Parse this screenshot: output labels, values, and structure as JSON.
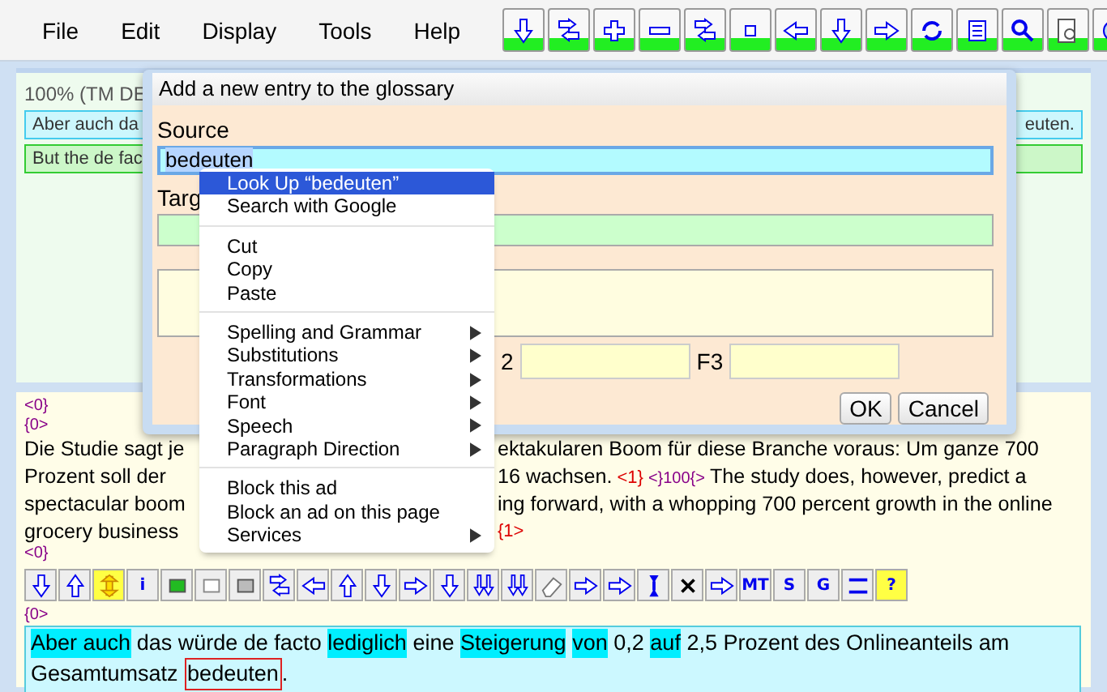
{
  "menubar": {
    "items": [
      "File",
      "Edit",
      "Display",
      "Tools",
      "Help"
    ]
  },
  "top_pane": {
    "match_label": "100% (TM DE",
    "source_row": {
      "left": "Aber auch da",
      "right": "euten."
    },
    "target_row": {
      "left": "But the de fac"
    }
  },
  "bottom_pane": {
    "tag_close": "<0}",
    "tag_open": "{0>",
    "paragraph": [
      {
        "left": "Die Studie sagt je",
        "right": [
          {
            "kind": "text",
            "text": "ektakularen Boom für diese Branche voraus: Um ganze 700"
          }
        ]
      },
      {
        "left": "Prozent soll der",
        "right": [
          {
            "kind": "text",
            "text": "16 wachsen."
          },
          {
            "kind": "tag-red",
            "text": "<1}"
          },
          {
            "kind": "tag",
            "text": "<}100{>"
          },
          {
            "kind": "text",
            "text": "The study does, however, predict a"
          }
        ]
      },
      {
        "left": "spectacular boom",
        "right": [
          {
            "kind": "text",
            "text": "ing forward, with a whopping 700 percent growth in the online"
          }
        ]
      },
      {
        "left": "grocery business",
        "right": [
          {
            "kind": "tag-red",
            "text": "{1>"
          }
        ]
      }
    ],
    "tag_close_2": "<0}",
    "toolbar_texts": [
      "i",
      "MT",
      "S",
      "G",
      "?"
    ],
    "tag_open_2": "{0>",
    "segment": [
      {
        "text": "Aber auch",
        "kind": "highlight"
      },
      {
        "text": "das würde de facto",
        "kind": "plain"
      },
      {
        "text": "lediglich",
        "kind": "highlight"
      },
      {
        "text": "eine",
        "kind": "plain"
      },
      {
        "text": "Steigerung",
        "kind": "highlight"
      },
      {
        "text": "von",
        "kind": "highlight"
      },
      {
        "text": "0,2",
        "kind": "plain"
      },
      {
        "text": "auf",
        "kind": "highlight"
      },
      {
        "text": "2,5 Prozent des Onlineanteils am",
        "kind": "plain"
      },
      {
        "text": "Gesamtumsatz",
        "kind": "plain"
      },
      {
        "text": "bedeuten",
        "kind": "boxed"
      },
      {
        "text": ".",
        "kind": "punct"
      }
    ]
  },
  "dialog": {
    "title": "Add a new entry to the glossary",
    "source_label": "Source",
    "source_value": "bedeuten",
    "target_label": "Targ",
    "f2_label": "2",
    "f3_label": "F3",
    "buttons": [
      "OK",
      "Cancel"
    ]
  },
  "context_menu": [
    {
      "label": "Look Up “bedeuten”",
      "selected": true,
      "submenu": false,
      "divider_after": false
    },
    {
      "label": "Search with Google",
      "selected": false,
      "submenu": false,
      "divider_after": true
    },
    {
      "label": "Cut",
      "selected": false,
      "submenu": false,
      "divider_after": false
    },
    {
      "label": "Copy",
      "selected": false,
      "submenu": false,
      "divider_after": false
    },
    {
      "label": "Paste",
      "selected": false,
      "submenu": false,
      "divider_after": true
    },
    {
      "label": "Spelling and Grammar",
      "selected": false,
      "submenu": true,
      "divider_after": false
    },
    {
      "label": "Substitutions",
      "selected": false,
      "submenu": true,
      "divider_after": false
    },
    {
      "label": "Transformations",
      "selected": false,
      "submenu": true,
      "divider_after": false
    },
    {
      "label": "Font",
      "selected": false,
      "submenu": true,
      "divider_after": false
    },
    {
      "label": "Speech",
      "selected": false,
      "submenu": true,
      "divider_after": false
    },
    {
      "label": "Paragraph Direction",
      "selected": false,
      "submenu": true,
      "divider_after": true
    },
    {
      "label": "Block this ad",
      "selected": false,
      "submenu": false,
      "divider_after": false
    },
    {
      "label": "Block an ad on this page",
      "selected": false,
      "submenu": false,
      "divider_after": false
    },
    {
      "label": "Services",
      "selected": false,
      "submenu": true,
      "divider_after": false
    }
  ]
}
